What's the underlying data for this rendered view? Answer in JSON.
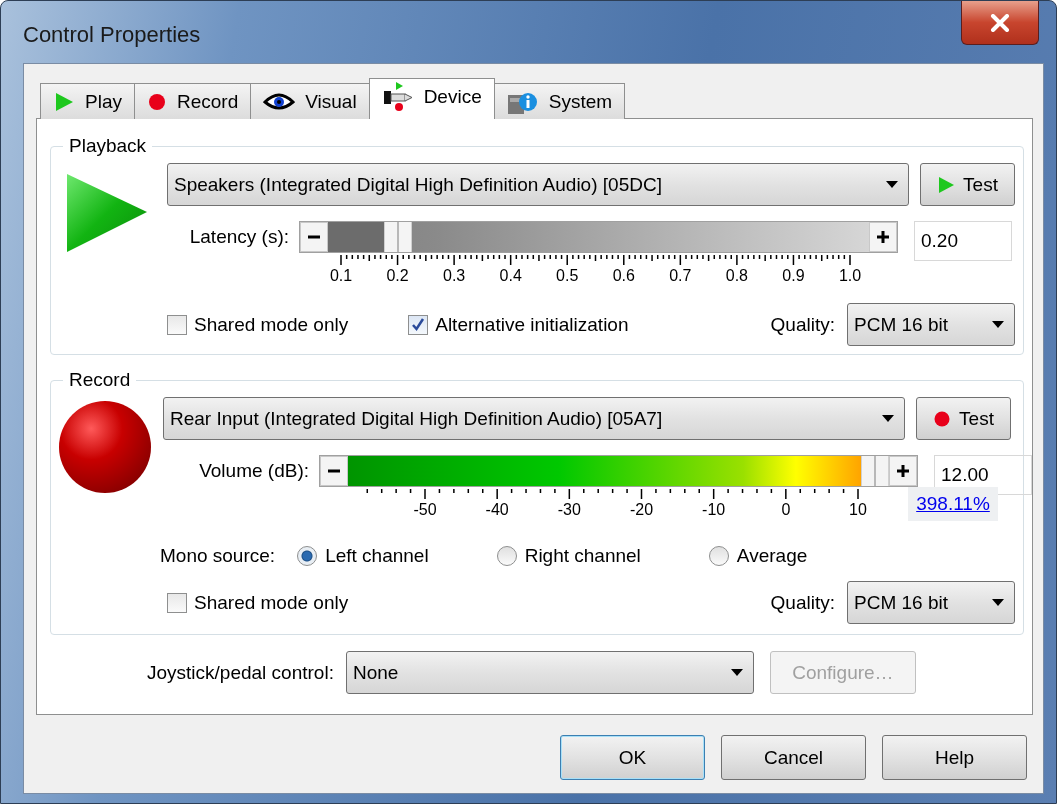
{
  "window": {
    "title": "Control Properties"
  },
  "tabs": [
    {
      "label": "Play",
      "kind": "play",
      "selected": false
    },
    {
      "label": "Record",
      "kind": "record",
      "selected": false
    },
    {
      "label": "Visual",
      "kind": "visual",
      "selected": false
    },
    {
      "label": "Device",
      "kind": "device",
      "selected": true
    },
    {
      "label": "System",
      "kind": "system",
      "selected": false
    }
  ],
  "playback": {
    "title": "Playback",
    "device": "Speakers (Integrated Digital High Definition Audio) [05DC]",
    "test": "Test",
    "slider": {
      "label": "Latency (s):",
      "level": 0.11,
      "value": "0.20",
      "scale": [
        "0.1",
        "0.2",
        "0.3",
        "0.4",
        "0.5",
        "0.6",
        "0.7",
        "0.8",
        "0.9",
        "1.0"
      ]
    },
    "options": [
      {
        "label": "Shared mode only",
        "checked": false
      },
      {
        "label": "Alternative initialization",
        "checked": true
      }
    ],
    "quality": {
      "label": "Quality:",
      "value": "PCM 16 bit"
    }
  },
  "record": {
    "title": "Record",
    "device": "Rear Input (Integrated Digital High Definition Audio) [05A7]",
    "test": "Test",
    "slider": {
      "label": "Volume (dB):",
      "level": 1,
      "value": "12.00",
      "percent": "398.11%",
      "scale": [
        "-50",
        "-40",
        "-30",
        "-20",
        "-10",
        "0",
        "10"
      ]
    },
    "mono": {
      "label": "Mono source:",
      "options": [
        {
          "label": "Left channel",
          "selected": true
        },
        {
          "label": "Right channel",
          "selected": false
        },
        {
          "label": "Average",
          "selected": false
        }
      ]
    },
    "options": [
      {
        "label": "Shared mode only",
        "checked": false
      }
    ],
    "quality": {
      "label": "Quality:",
      "value": "PCM 16 bit"
    }
  },
  "joystick": {
    "label": "Joystick/pedal control:",
    "value": "None",
    "configure": {
      "label": "Configure…",
      "disabled": true
    }
  },
  "buttons": [
    {
      "label": "OK",
      "default": true
    },
    {
      "label": "Cancel",
      "default": false
    },
    {
      "label": "Help",
      "default": false
    }
  ]
}
